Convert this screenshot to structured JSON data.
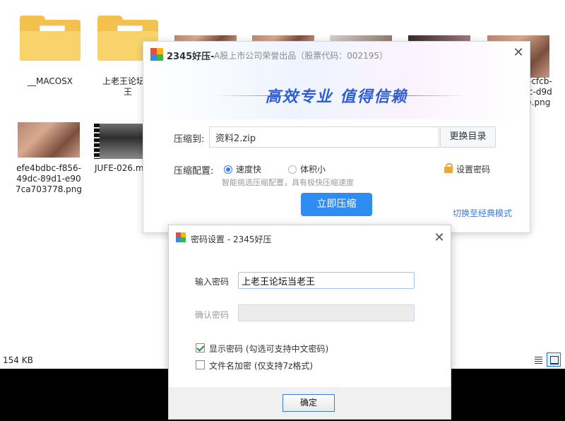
{
  "explorer": {
    "files": [
      {
        "name": "__MACOSX",
        "type": "folder"
      },
      {
        "name": "上老王论坛当老王",
        "display": "上老王论坛当\n王",
        "type": "folder"
      },
      {
        "name": "efe4bdbc-f856-49dc-89d1-e907ca703778.png",
        "display": "efe4bdbc-f856-\n49dc-89d1-e90\n7ca703778.png",
        "type": "image"
      },
      {
        "name": "JUFE-026.mp4",
        "display": "JUFE-026.m",
        "type": "video"
      },
      {
        "name": "-cfcb-c-d9d-.png",
        "display": "-cfcb-\nc-d9d\n).png",
        "type": "image"
      }
    ],
    "status_size": "154 KB",
    "view_buttons": [
      {
        "icon": "details-view-icon",
        "active": false
      },
      {
        "icon": "large-icons-view-icon",
        "active": true
      }
    ]
  },
  "compress_dialog": {
    "app_name": "2345好压-",
    "title_sub": "A股上市公司荣誉出品（股票代码：002195）",
    "slogan": "高效专业  值得信赖",
    "compress_to_label": "压缩到:",
    "path_value": "资料2.zip",
    "change_dir_label": "更换目录",
    "config_label": "压缩配置:",
    "options": [
      {
        "label": "速度快",
        "selected": true
      },
      {
        "label": "体积小",
        "selected": false
      }
    ],
    "config_hint": "智能挑选压缩配置，具有极快压缩速度",
    "set_password_label": "设置密码",
    "compress_now_label": "立即压缩",
    "classic_mode_label": "切换至经典模式",
    "close_icon": "close-icon"
  },
  "password_dialog": {
    "title": "密码设置 - 2345好压",
    "enter_label": "输入密码",
    "enter_value": "上老王论坛当老王",
    "confirm_label": "确认密码",
    "confirm_value": "",
    "show_password": {
      "label": "显示密码 (勾选可支持中文密码)",
      "checked": true
    },
    "encrypt_names": {
      "label": "文件名加密 (仅支持7z格式)",
      "checked": false
    },
    "ok_label": "确定"
  },
  "colors": {
    "accent": "#2f8cf3",
    "slogan": "#2f5fd7",
    "folder": "#f2c14e",
    "link": "#3d7bd9"
  }
}
